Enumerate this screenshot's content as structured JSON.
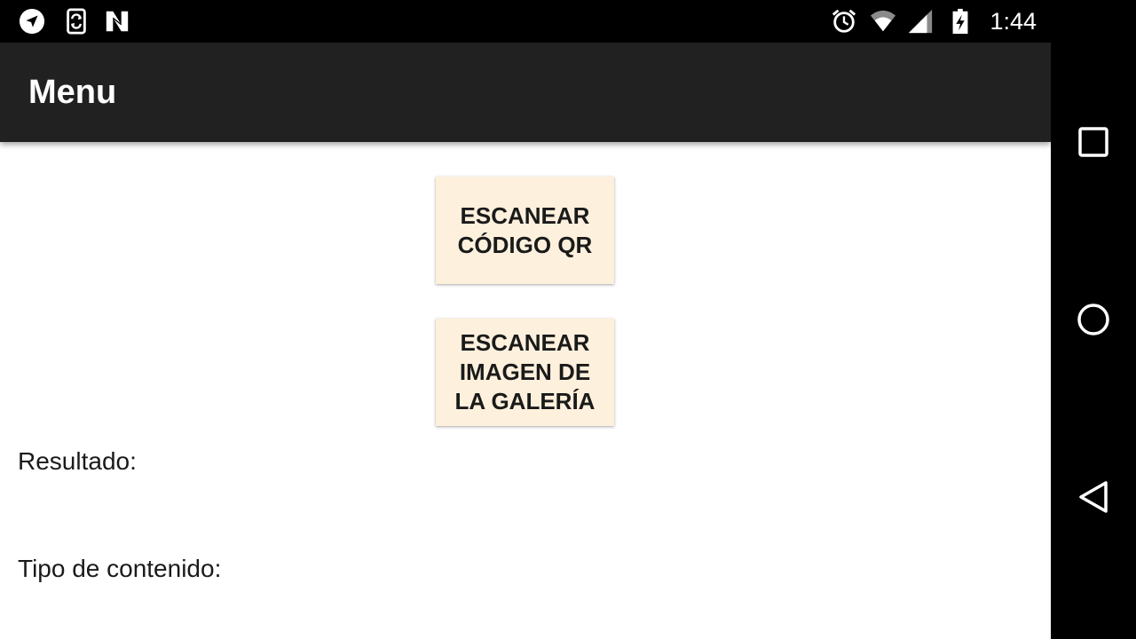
{
  "status_bar": {
    "time": "1:44",
    "left_icons": [
      "navigation-arrow-icon",
      "phone-sync-icon",
      "n-logo-icon"
    ],
    "right_icons": [
      "alarm-icon",
      "wifi-icon",
      "cell-signal-icon",
      "battery-charging-icon"
    ]
  },
  "app_bar": {
    "title": "Menu",
    "background_color": "#212121"
  },
  "buttons": {
    "scan_qr": "ESCANEAR CÓDIGO QR",
    "scan_gallery": "ESCANEAR IMAGEN DE LA GALERÍA",
    "background_color": "#fdf0dc"
  },
  "fields": {
    "result_label": "Resultado:",
    "content_type_label": "Tipo de contenido:"
  },
  "nav_bar": {
    "buttons": [
      "recents-square-icon",
      "home-circle-icon",
      "back-triangle-icon"
    ]
  }
}
